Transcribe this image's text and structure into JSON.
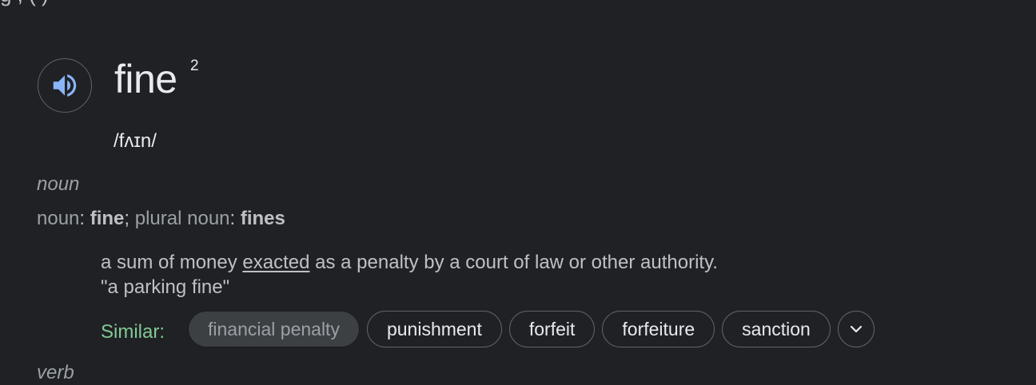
{
  "cut_text": "g                                                      ,                                                     (                )",
  "entry": {
    "word": "fine",
    "homograph_number": "2",
    "phonetic": "/fʌɪn/"
  },
  "noun_section": {
    "pos_label": "noun",
    "forms": {
      "noun_label": "noun",
      "noun_value": "fine",
      "plural_label": "plural noun",
      "plural_value": "fines",
      "colon": ":",
      "separator": ";"
    },
    "definition": {
      "before": "a sum of money ",
      "link": "exacted",
      "after": " as a penalty by a court of law or other authority."
    },
    "example": "\"a parking fine\"",
    "similar_label": "Similar:",
    "similar": [
      "financial penalty",
      "punishment",
      "forfeit",
      "forfeiture",
      "sanction"
    ]
  },
  "verb_section": {
    "pos_label": "verb"
  },
  "colors": {
    "background": "#202124",
    "primary_text": "#e8eaed",
    "secondary_text": "#9aa0a6",
    "similar_label": "#81c995",
    "speaker_icon": "#8ab4f8"
  },
  "icons": {
    "speaker": "volume-up-icon",
    "expand": "chevron-down-icon"
  }
}
